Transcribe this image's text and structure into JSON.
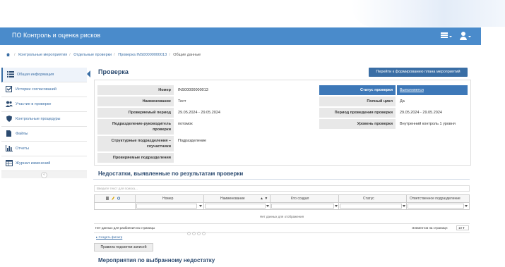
{
  "app": {
    "title": "ПО Контроль и оценка рисков"
  },
  "breadcrumb": [
    "Контрольные мероприятия",
    "Отдельные проверки",
    "Проверка INS00000000013",
    "Общие данные"
  ],
  "sidebar": {
    "items": [
      {
        "label": "Общая информация",
        "icon": "list-icon"
      },
      {
        "label": "Истории согласований",
        "icon": "checkbox-icon"
      },
      {
        "label": "Участие в проверке",
        "icon": "users-icon"
      },
      {
        "label": "Контрольные процедуры",
        "icon": "shield-icon"
      },
      {
        "label": "Файлы",
        "icon": "file-icon"
      },
      {
        "label": "Отчеты",
        "icon": "bar-chart-icon"
      },
      {
        "label": "Журнал изменений",
        "icon": "table-icon"
      }
    ],
    "collapse_label": "«"
  },
  "page": {
    "title": "Проверка",
    "plan_button": "Перейти к формированию плана мероприятий"
  },
  "details": {
    "left": [
      {
        "label": "Номер",
        "value": "INS00000000013"
      },
      {
        "label": "Наименование",
        "value": "Тест"
      },
      {
        "label": "Проверяемый период",
        "value": "29.05.2024 - 29.05.2024"
      },
      {
        "label": "Подразделение-руководитель проверки",
        "value": "потомок"
      },
      {
        "label": "Структурные подразделения – соучастники",
        "value": "Подразделение"
      },
      {
        "label": "Проверяемые подразделения",
        "value": ""
      }
    ],
    "right": [
      {
        "label": "Статус проверки",
        "value": "Выполняется"
      },
      {
        "label": "Полный цикл",
        "value": "Да"
      },
      {
        "label": "Период проведения проверки",
        "value": "29.05.2024 - 29.05.2024"
      },
      {
        "label": "Уровень проверки",
        "value": "Внутренний контроль 1 уровня"
      }
    ]
  },
  "deficiencies": {
    "title": "Недостатки, выявленные по результатам проверки",
    "search_placeholder": "Введите текст для поиска...",
    "columns": [
      "Номер",
      "Наименование",
      "Кто создал",
      "Статус",
      "Ответственное подразделение"
    ],
    "empty_text": "Нет данных для отображения",
    "pager_left": "Нет данных для разбиения на страницы",
    "per_page_label": "Элементов на странице:",
    "per_page_value": "10",
    "create_filter": "Создать фильтр",
    "rules_button": "Правила подсветки записей"
  },
  "measures": {
    "title": "Мероприятия по выбранному недостатку"
  },
  "colors": {
    "header": "#4a8bcb",
    "accent": "#3d78b8",
    "title": "#2b4a6f"
  }
}
